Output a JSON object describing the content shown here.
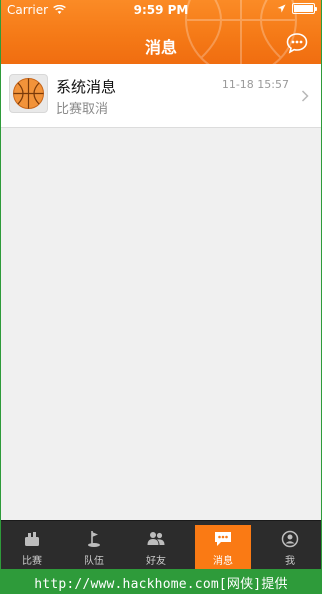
{
  "status_bar": {
    "carrier": "Carrier",
    "time": "9:59 PM"
  },
  "header": {
    "title": "消息",
    "chat_icon": "speech-bubble-dots-icon",
    "accent_color": "#f57a17"
  },
  "messages": [
    {
      "title": "系统消息",
      "subtitle": "比赛取消",
      "time": "11-18 15:57",
      "icon": "basketball-icon"
    }
  ],
  "tabbar": {
    "items": [
      {
        "label": "比赛",
        "icon": "match-icon",
        "active": false
      },
      {
        "label": "队伍",
        "icon": "team-flag-icon",
        "active": false
      },
      {
        "label": "好友",
        "icon": "friends-icon",
        "active": false
      },
      {
        "label": "消息",
        "icon": "message-icon",
        "active": true
      },
      {
        "label": "我",
        "icon": "profile-icon",
        "active": false
      }
    ]
  },
  "watermark": "http://www.hackhome.com[网侠]提供"
}
